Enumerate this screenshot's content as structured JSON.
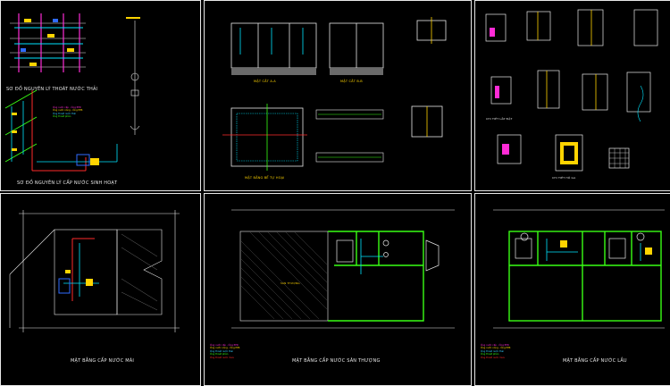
{
  "colors": {
    "background": "#000000",
    "frame": "#e8e8e8",
    "wall_green": "#39ff14",
    "cyan": "#00e5ff",
    "yellow": "#ffd400",
    "magenta": "#ff2bd6",
    "red": "#ff2a2a",
    "blue": "#2f6bff",
    "white": "#f0f0f0"
  },
  "sheets": {
    "s1": {
      "title_drainage": "SƠ ĐỒ NGUYÊN LÝ THOÁT NƯỚC THẢI",
      "title_supply": "SƠ ĐỒ NGUYÊN LÝ CẤP NƯỚC SINH HOẠT"
    },
    "s2": {
      "section_a": "MẶT CẮT A-A",
      "section_b": "MẶT CẮT B-B",
      "plan_tank": "MẶT BẰNG BỂ TỰ HOẠI"
    },
    "s3": {
      "detail_1": "CHI TIẾT LẮP ĐẶT",
      "detail_2": "CHI TIẾT HỐ GA"
    },
    "s4": {
      "title": "MẶT BẰNG CẤP NƯỚC MÁI"
    },
    "s5": {
      "title": "MẶT BẰNG CẤP NƯỚC SÂN THƯỢNG",
      "room_label": "SÂN THƯỢNG"
    },
    "s6": {
      "title": "MẶT BẰNG CẤP NƯỚC LẦU"
    }
  },
  "legend": {
    "items": [
      "Ống nước cấp - Ống PPR",
      "Ống nước nóng - Ống PPR",
      "Ống thoát nước thải",
      "Ống thoát phân",
      "Ống thoát nước mưa"
    ]
  }
}
